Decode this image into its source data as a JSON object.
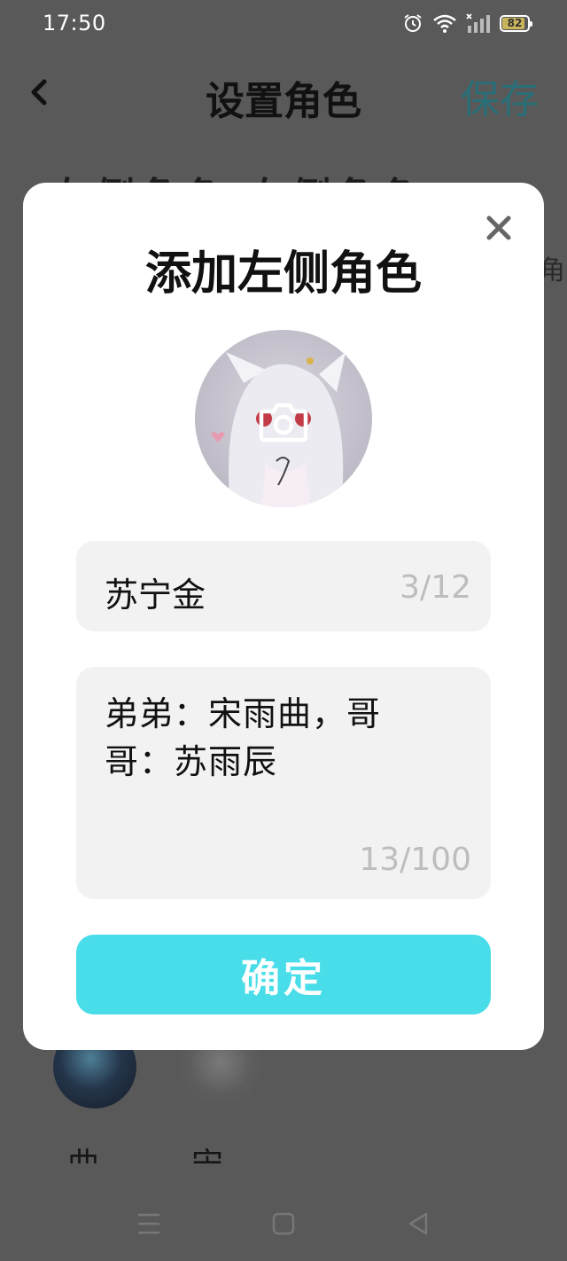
{
  "status_bar": {
    "time": "17:50",
    "battery": "82",
    "icons": [
      "alarm-icon",
      "wifi-icon",
      "signal-icon",
      "battery-icon"
    ]
  },
  "header": {
    "title": "设置角色",
    "save_label": "保存",
    "back_icon": "chevron-left-icon"
  },
  "background": {
    "tabs_text": "左侧角色 右侧角色",
    "side_text": "角",
    "characters": [
      {
        "name": "曲"
      },
      {
        "name": "宋"
      }
    ]
  },
  "modal": {
    "title": "添加左侧角色",
    "close_icon": "close-icon",
    "avatar_icon": "camera-icon",
    "name_value": "苏宁金",
    "name_count": "3/12",
    "desc_value": "弟弟：宋雨曲，哥哥：苏雨辰",
    "desc_count": "13/100",
    "confirm_label": "确定"
  },
  "nav_bar": {
    "icons": [
      "menu-icon",
      "home-icon",
      "back-icon"
    ]
  },
  "colors": {
    "accent": "#48dde8",
    "save_text": "#2a6f78",
    "overlay": "#595959"
  }
}
